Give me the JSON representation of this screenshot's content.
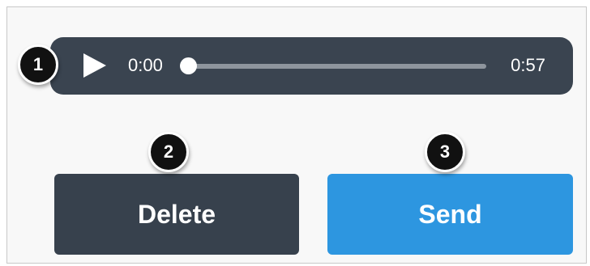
{
  "player": {
    "current_time": "0:00",
    "duration": "0:57",
    "progress": 0,
    "play_icon": "play-icon"
  },
  "buttons": {
    "delete_label": "Delete",
    "send_label": "Send"
  },
  "badges": {
    "one": "1",
    "two": "2",
    "three": "3"
  },
  "colors": {
    "player_bg": "#3a4450",
    "delete_bg": "#37414d",
    "send_bg": "#2d96e0",
    "badge_bg": "#111111"
  }
}
